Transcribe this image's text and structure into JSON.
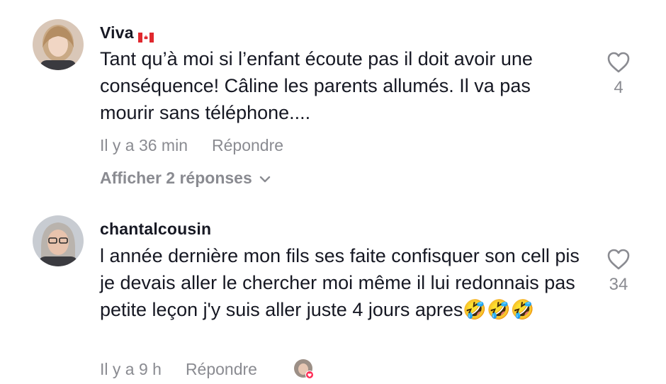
{
  "comments": [
    {
      "username": "Viva",
      "flag_icon": "canada-flag-icon",
      "text": "Tant qu’à moi si l’enfant écoute pas il doit avoir une conséquence! Câline les parents allumés. Il va pas mourir sans téléphone....",
      "time": "Il y a 36 min",
      "reply_label": "Répondre",
      "likes": "4",
      "view_replies": "Afficher 2 réponses"
    },
    {
      "username": "chantalcousin",
      "text": "l année dernière mon fils ses faite confisquer son cell pis je devais aller le chercher moi même il lui redonnais pas petite leçon j'y suis aller juste 4 jours apres🤣🤣🤣",
      "time": "Il y a 9 h",
      "reply_label": "Répondre",
      "likes": "34",
      "creator_liked_icon": "creator-liked-avatar-icon"
    }
  ],
  "colors": {
    "text_primary": "#161823",
    "text_secondary": "#8a8b91",
    "heart_outline": "#8a8b91",
    "like_badge": "#fe2c55"
  }
}
